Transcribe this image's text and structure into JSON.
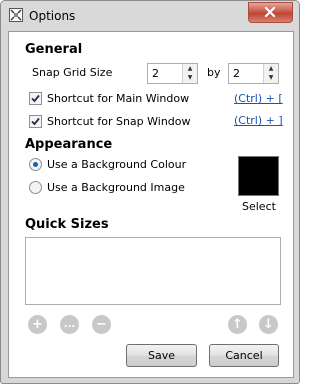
{
  "window": {
    "title": "Options"
  },
  "general": {
    "heading": "General",
    "snap_grid_label": "Snap Grid Size",
    "snap_x": "2",
    "by_label": "by",
    "snap_y": "2",
    "shortcut_main_label": "Shortcut for Main Window",
    "shortcut_main_checked": true,
    "shortcut_main_link": "(Ctrl) + [",
    "shortcut_snap_label": "Shortcut for Snap Window",
    "shortcut_snap_checked": true,
    "shortcut_snap_link": "(Ctrl) + ]"
  },
  "appearance": {
    "heading": "Appearance",
    "option_colour": "Use a Background Colour",
    "option_image": "Use a Background Image",
    "selected": "colour",
    "swatch_color": "#000000",
    "select_label": "Select"
  },
  "quick_sizes": {
    "heading": "Quick Sizes",
    "add_symbol": "+",
    "more_symbol": "...",
    "remove_symbol": "−",
    "up_symbol": "↑",
    "down_symbol": "↓"
  },
  "buttons": {
    "save": "Save",
    "cancel": "Cancel"
  },
  "colors": {
    "link": "#1a53b5",
    "radio_dot": "#1c5da8",
    "close_button": "#c75a4a"
  }
}
